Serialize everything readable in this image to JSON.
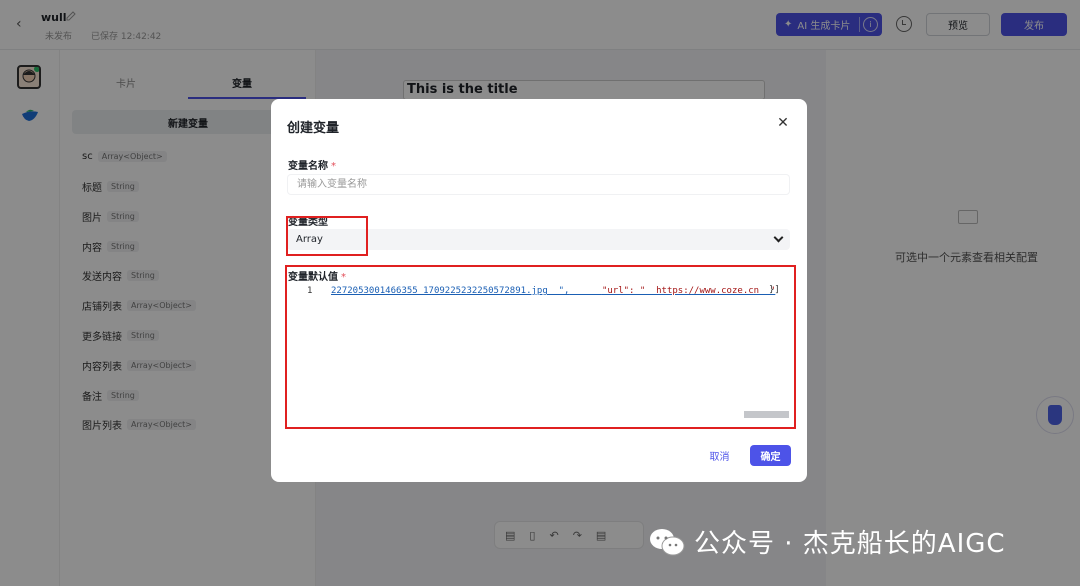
{
  "header": {
    "doc_title": "wull",
    "status": "未发布",
    "saved": "已保存 12:42:42",
    "ai_button": "AI 生成卡片",
    "preview": "预览",
    "publish": "发布"
  },
  "var_panel": {
    "tab_card": "卡片",
    "tab_variables": "变量",
    "new_variable": "新建变量",
    "items": [
      {
        "name": "sc",
        "type": "Array<Object>"
      },
      {
        "name": "标题",
        "type": "String"
      },
      {
        "name": "图片",
        "type": "String"
      },
      {
        "name": "内容",
        "type": "String"
      },
      {
        "name": "发送内容",
        "type": "String"
      },
      {
        "name": "店铺列表",
        "type": "Array<Object>"
      },
      {
        "name": "更多链接",
        "type": "String"
      },
      {
        "name": "内容列表",
        "type": "Array<Object>"
      },
      {
        "name": "备注",
        "type": "String"
      },
      {
        "name": "图片列表",
        "type": "Array<Object>"
      }
    ]
  },
  "canvas": {
    "title": "This is the title"
  },
  "right_panel": {
    "empty_text": "可选中一个元素查看相关配置"
  },
  "watermark": "公众号 · 杰克船长的AIGC",
  "modal": {
    "title": "创建变量",
    "name_label": "变量名称",
    "name_placeholder": "请输入变量名称",
    "type_label": "变量类型",
    "type_value": "Array",
    "default_label": "变量默认值",
    "required_mark": "*",
    "editor": {
      "line_number": "1",
      "code_a": "2272053001466355_1709225232250572891.jpg  \",",
      "code_b": "\"url\": \"  https://www.coze.cn  \"",
      "code_end": "}]"
    },
    "cancel": "取消",
    "confirm": "确定"
  },
  "colors": {
    "accent": "#4d53e8",
    "highlight_box": "#e02020"
  }
}
